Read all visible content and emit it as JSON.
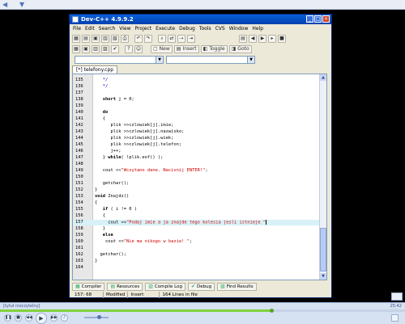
{
  "window": {
    "title": "Dev-C++ 4.9.9.2"
  },
  "menu": [
    "File",
    "Edit",
    "Search",
    "View",
    "Project",
    "Execute",
    "Debug",
    "Tools",
    "CVS",
    "Window",
    "Help"
  ],
  "toolbar2": {
    "new_label": "New",
    "insert_label": "Insert",
    "toggle_label": "Toggle",
    "goto_label": "Goto"
  },
  "file_tab": "[*] telefony.cpp",
  "code_lines": [
    {
      "num": "135",
      "code": "   */"
    },
    {
      "num": "136",
      "code": "   */"
    },
    {
      "num": "137",
      "code": ""
    },
    {
      "num": "138",
      "code": "   short j = 0;"
    },
    {
      "num": "139",
      "code": ""
    },
    {
      "num": "140",
      "code": "   do"
    },
    {
      "num": "141",
      "code": "   {"
    },
    {
      "num": "142",
      "code": "      plik >>czlowiek[j].imie;"
    },
    {
      "num": "143",
      "code": "      plik >>czlowiek[j].nazwisko;"
    },
    {
      "num": "144",
      "code": "      plik >>czlowiek[j].wiek;"
    },
    {
      "num": "145",
      "code": "      plik >>czlowiek[j].telefon;"
    },
    {
      "num": "146",
      "code": "      j++;"
    },
    {
      "num": "147",
      "code": "   } while( !plik.eof() );"
    },
    {
      "num": "148",
      "code": ""
    },
    {
      "num": "149",
      "code": "   cout <<\"Wczytano dane. Nacisnij ENTER!\";"
    },
    {
      "num": "150",
      "code": ""
    },
    {
      "num": "151",
      "code": "   getchar();"
    },
    {
      "num": "152",
      "code": "}"
    },
    {
      "num": "153",
      "code": "void Znajdz()"
    },
    {
      "num": "154",
      "code": "{"
    },
    {
      "num": "155",
      "code": "   if ( i != 0 )"
    },
    {
      "num": "156",
      "code": "   {"
    },
    {
      "num": "157",
      "code": "     cout <<\"Podaj imie a ja znajde tego kolesia jesli istnieje \""
    },
    {
      "num": "158",
      "code": "   }"
    },
    {
      "num": "159",
      "code": "   else"
    },
    {
      "num": "160",
      "code": "    cout <<\"Nie ma nikogo w bazie! \";"
    },
    {
      "num": "161",
      "code": ""
    },
    {
      "num": "162",
      "code": "  getchar();"
    },
    {
      "num": "163",
      "code": "}"
    },
    {
      "num": "164",
      "code": ""
    }
  ],
  "highlighted_line": "157",
  "bottom_tabs": [
    "Compiler",
    "Resources",
    "Compile Log",
    "Debug",
    "Find Results"
  ],
  "status": {
    "position": "157: 68",
    "modified": "Modified",
    "mode": "Insert",
    "lines": "164 Lines in file"
  },
  "player": {
    "info": "[tytuł nieczytelny]",
    "time": "25:42",
    "progress": 0.67,
    "volume": 0.6
  }
}
